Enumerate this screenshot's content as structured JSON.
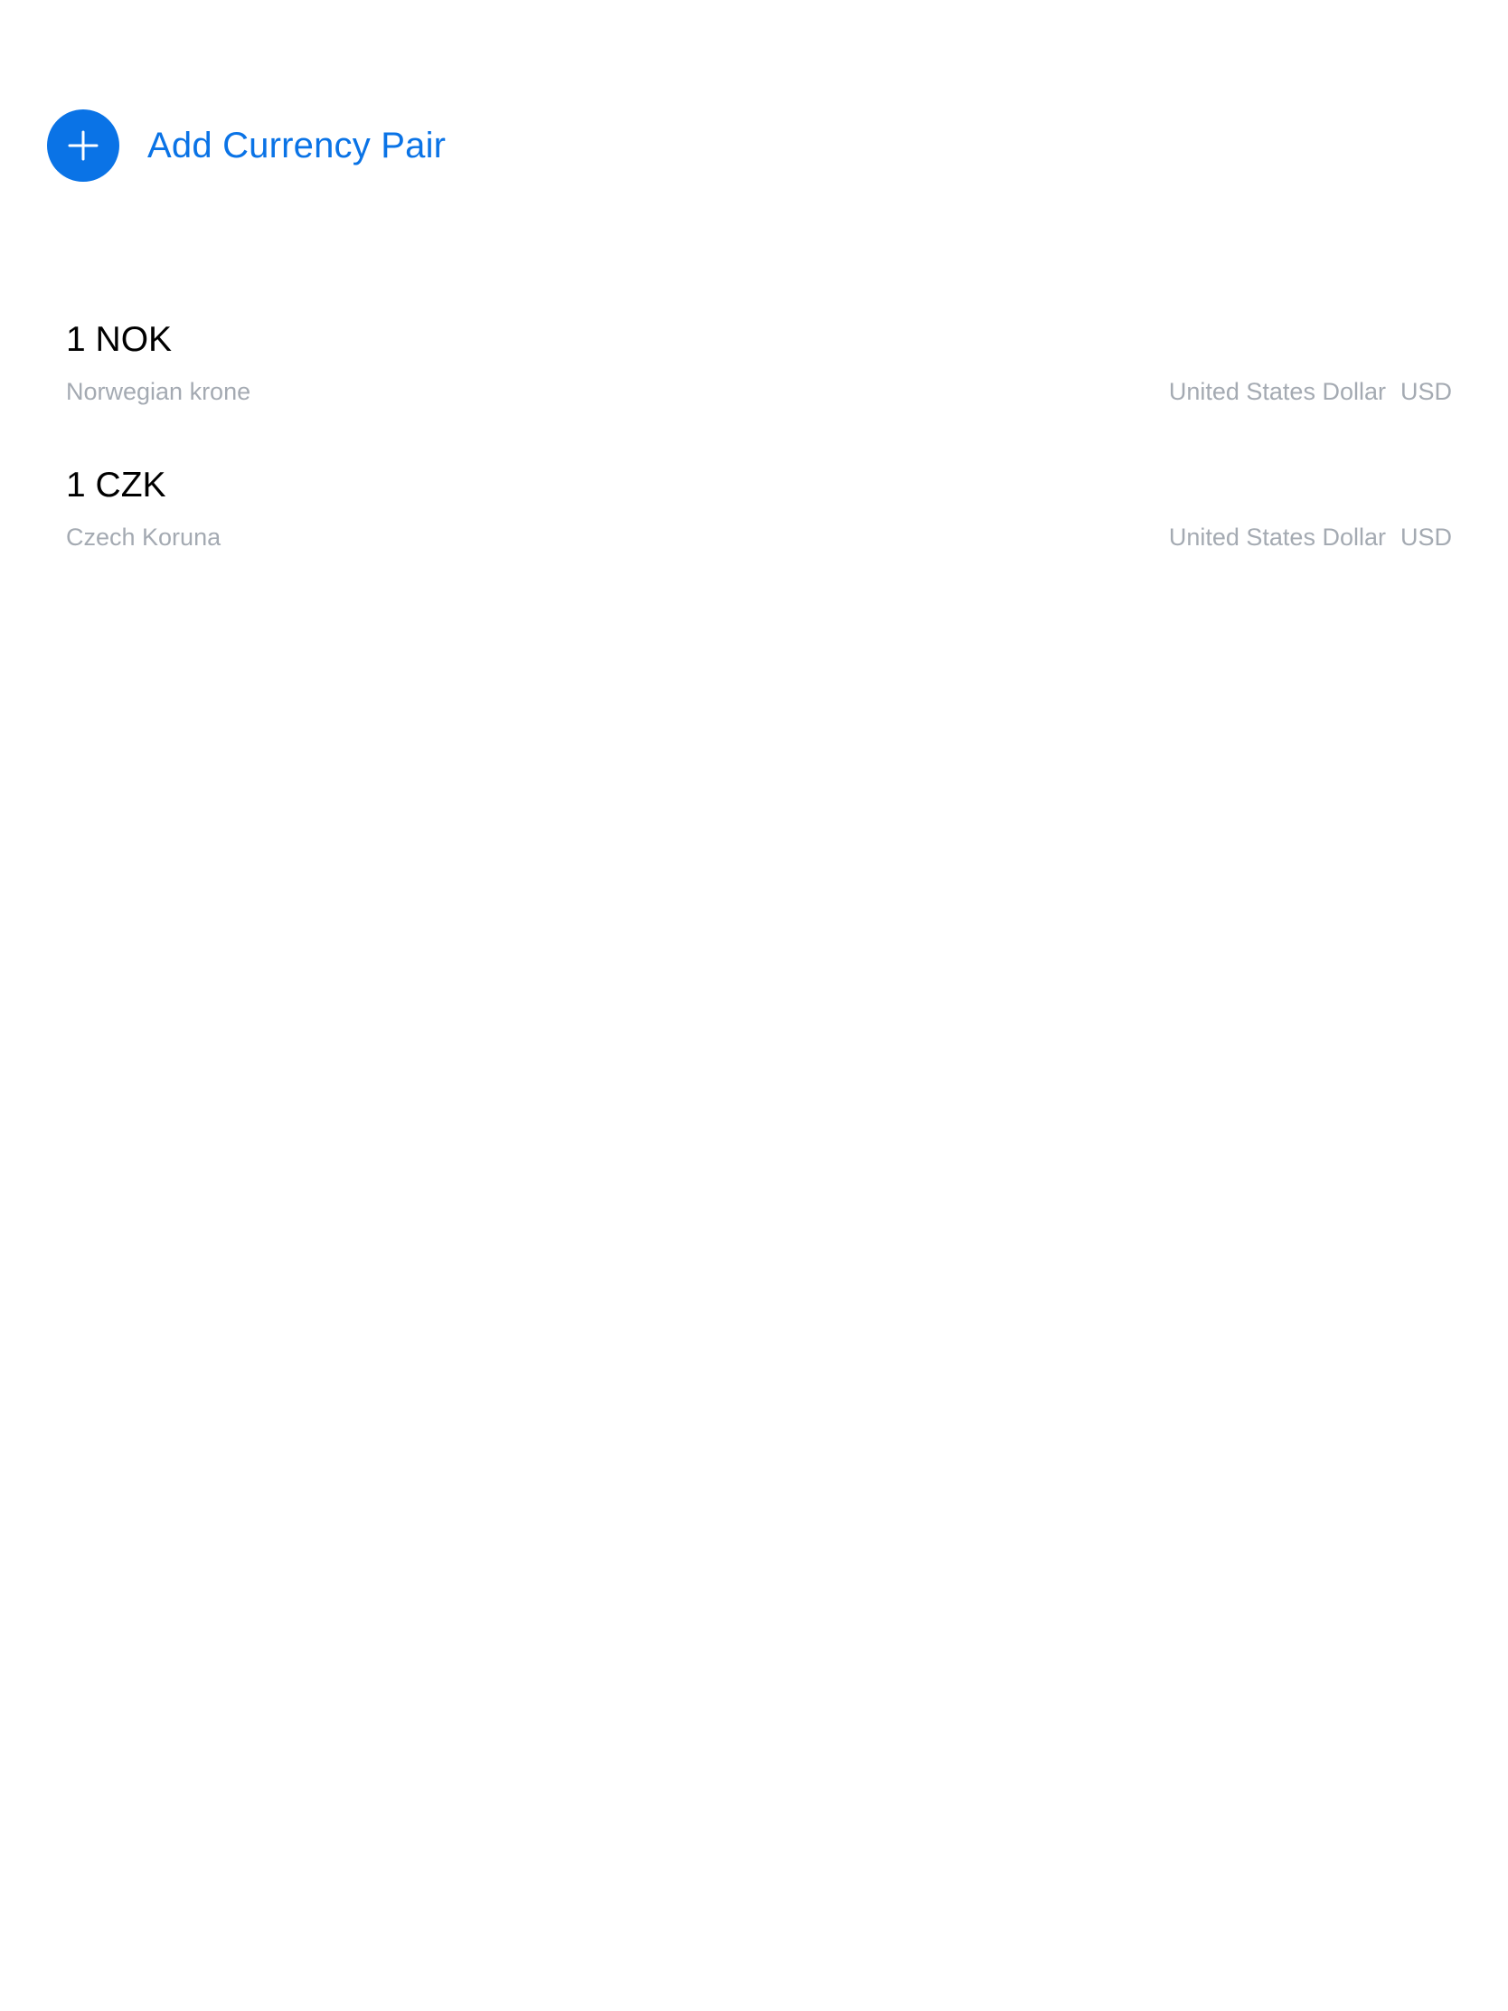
{
  "add_pair": {
    "label": "Add Currency Pair",
    "icon": "plus-icon",
    "accent_color": "#0a73e6"
  },
  "pairs": [
    {
      "amount": "1 NOK",
      "name": "Norwegian krone",
      "target_name": "United States Dollar",
      "target_code": "USD"
    },
    {
      "amount": "1 CZK",
      "name": "Czech Koruna",
      "target_name": "United States Dollar",
      "target_code": "USD"
    }
  ],
  "colors": {
    "primary_text": "#000000",
    "secondary_text": "#a4aab2",
    "background": "#ffffff"
  }
}
